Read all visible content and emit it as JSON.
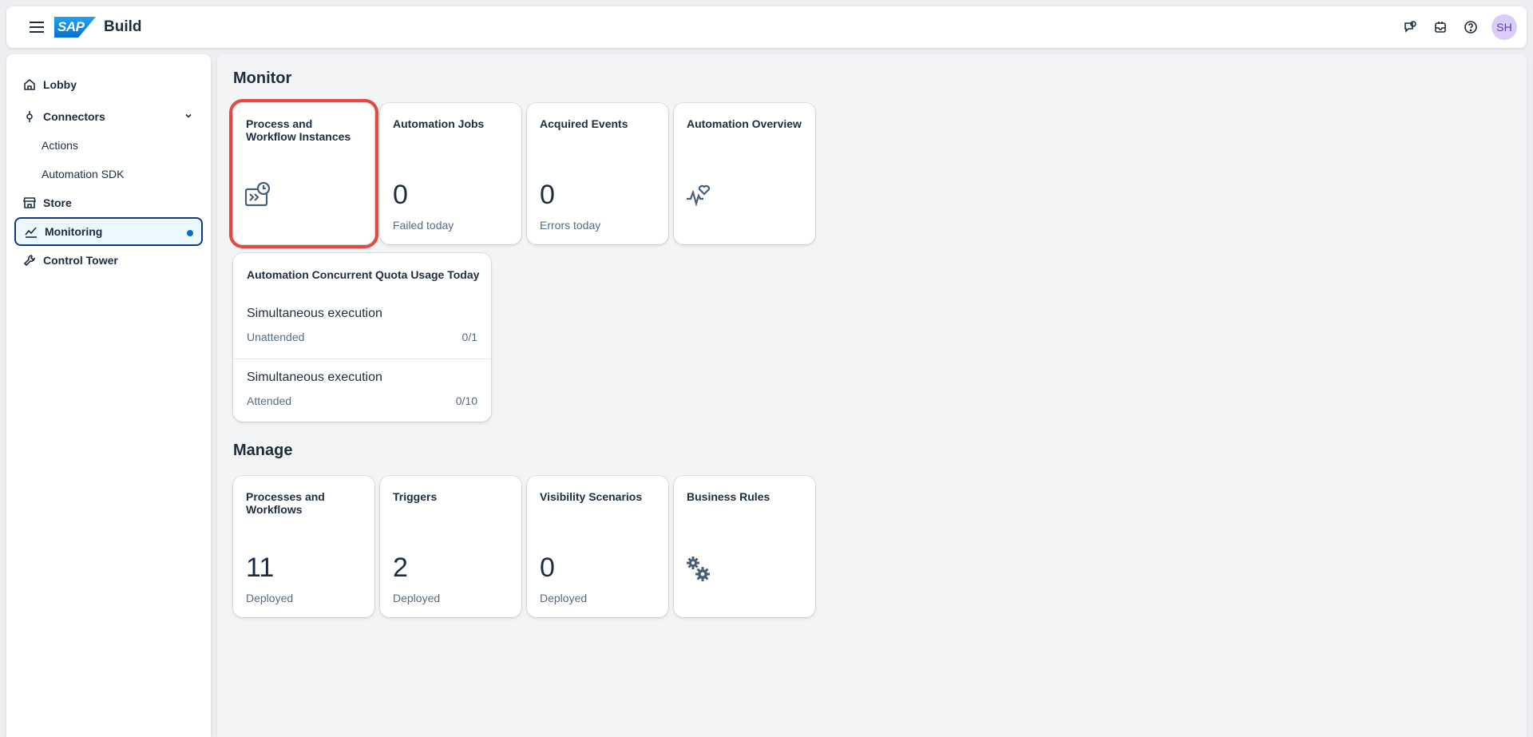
{
  "header": {
    "logo_text": "SAP",
    "product": "Build",
    "avatar_initials": "SH"
  },
  "sidebar": {
    "items": [
      {
        "label": "Lobby",
        "icon": "home-icon"
      },
      {
        "label": "Connectors",
        "icon": "connector-icon",
        "expanded": true
      },
      {
        "label": "Actions"
      },
      {
        "label": "Automation SDK"
      },
      {
        "label": "Store",
        "icon": "store-icon"
      },
      {
        "label": "Monitoring",
        "icon": "monitoring-icon",
        "selected": true
      },
      {
        "label": "Control Tower",
        "icon": "wrench-icon"
      }
    ]
  },
  "monitor": {
    "title": "Monitor",
    "tiles": [
      {
        "title": "Process and Workflow Instances",
        "icon": "process-instances-icon"
      },
      {
        "title": "Automation Jobs",
        "value": "0",
        "footer": "Failed today"
      },
      {
        "title": "Acquired Events",
        "value": "0",
        "footer": "Errors today"
      },
      {
        "title": "Automation Overview",
        "icon": "heart-pulse-icon"
      }
    ],
    "quota": {
      "title": "Automation Concurrent Quota Usage Today",
      "rows": [
        {
          "name": "Simultaneous execution",
          "sub": "Unattended",
          "value": "0/1"
        },
        {
          "name": "Simultaneous execution",
          "sub": "Attended",
          "value": "0/10"
        }
      ]
    }
  },
  "manage": {
    "title": "Manage",
    "tiles": [
      {
        "title": "Processes and Workflows",
        "value": "11",
        "footer": "Deployed"
      },
      {
        "title": "Triggers",
        "value": "2",
        "footer": "Deployed"
      },
      {
        "title": "Visibility Scenarios",
        "value": "0",
        "footer": "Deployed"
      },
      {
        "title": "Business Rules",
        "icon": "gears-icon"
      }
    ]
  },
  "colors": {
    "accent": "#0a6ed1",
    "highlight_outline": "#e8473f",
    "selected_bg": "#ebf8ff"
  }
}
